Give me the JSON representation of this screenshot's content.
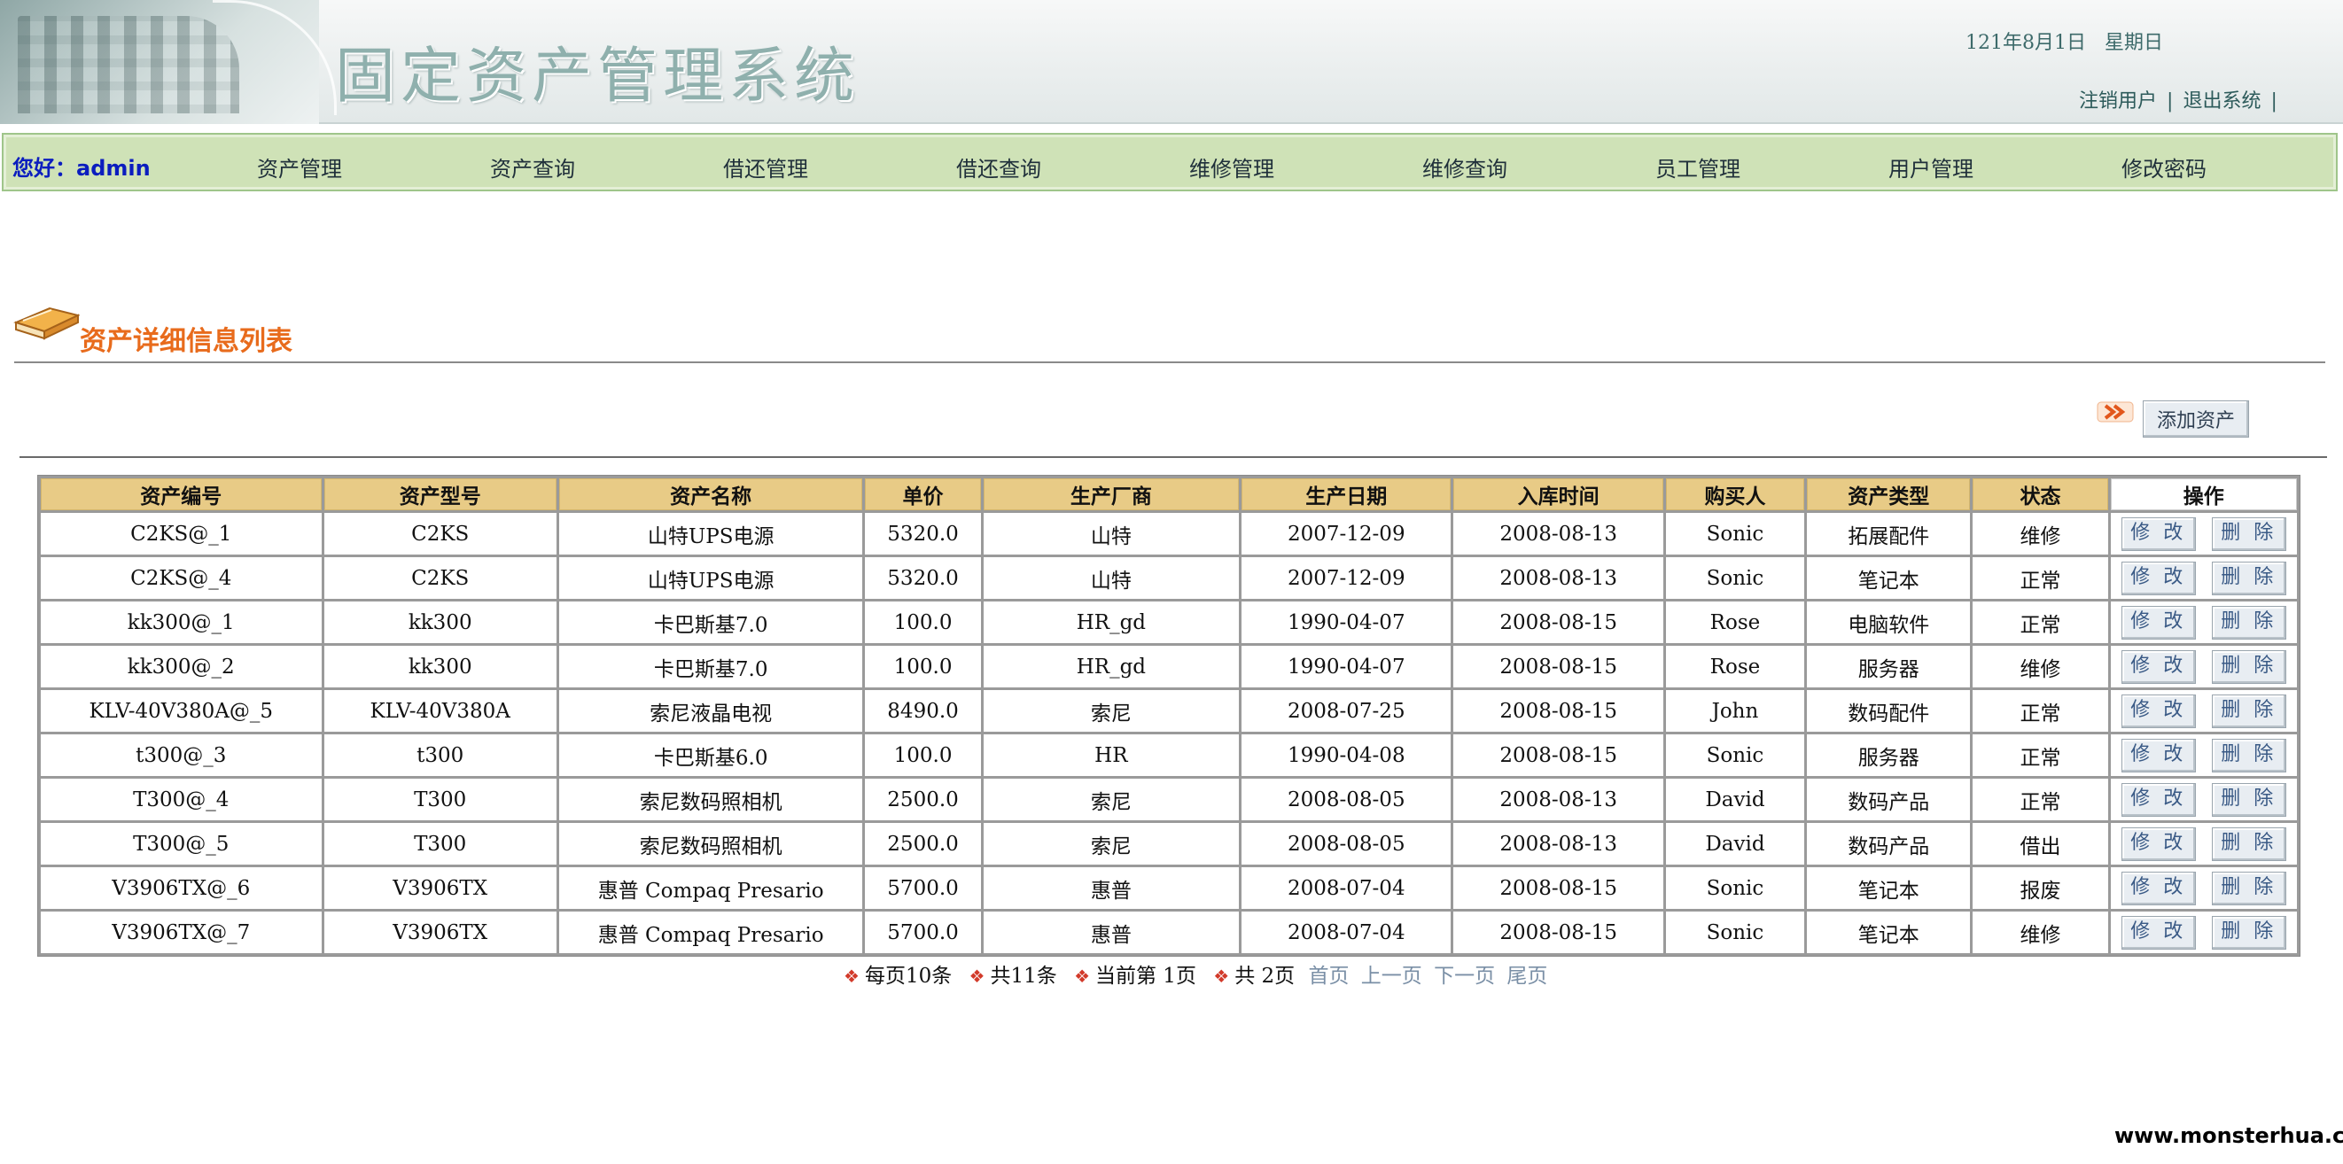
{
  "header": {
    "title": "固定资产管理系统",
    "date_text": "121年8月1日   星期日",
    "logout_user": "注销用户",
    "separator": "|",
    "exit_system": "退出系统",
    "trailing_separator": "|"
  },
  "nav": {
    "greeting": "您好：admin",
    "items": [
      {
        "label": "资产管理"
      },
      {
        "label": "资产查询"
      },
      {
        "label": "借还管理"
      },
      {
        "label": "借还查询"
      },
      {
        "label": "维修管理"
      },
      {
        "label": "维修查询"
      },
      {
        "label": "员工管理"
      },
      {
        "label": "用户管理"
      },
      {
        "label": "修改密码"
      }
    ]
  },
  "section": {
    "title": "资产详细信息列表",
    "add_button": "添加资产"
  },
  "table": {
    "headers": [
      "资产编号",
      "资产型号",
      "资产名称",
      "单价",
      "生产厂商",
      "生产日期",
      "入库时间",
      "购买人",
      "资产类型",
      "状态",
      "操作"
    ],
    "edit_label": "修 改",
    "delete_label": "删 除",
    "rows": [
      [
        "C2KS@_1",
        "C2KS",
        "山特UPS电源",
        "5320.0",
        "山特",
        "2007-12-09",
        "2008-08-13",
        "Sonic",
        "拓展配件",
        "维修"
      ],
      [
        "C2KS@_4",
        "C2KS",
        "山特UPS电源",
        "5320.0",
        "山特",
        "2007-12-09",
        "2008-08-13",
        "Sonic",
        "笔记本",
        "正常"
      ],
      [
        "kk300@_1",
        "kk300",
        "卡巴斯基7.0",
        "100.0",
        "HR_gd",
        "1990-04-07",
        "2008-08-15",
        "Rose",
        "电脑软件",
        "正常"
      ],
      [
        "kk300@_2",
        "kk300",
        "卡巴斯基7.0",
        "100.0",
        "HR_gd",
        "1990-04-07",
        "2008-08-15",
        "Rose",
        "服务器",
        "维修"
      ],
      [
        "KLV-40V380A@_5",
        "KLV-40V380A",
        "索尼液晶电视",
        "8490.0",
        "索尼",
        "2008-07-25",
        "2008-08-15",
        "John",
        "数码配件",
        "正常"
      ],
      [
        "t300@_3",
        "t300",
        "卡巴斯基6.0",
        "100.0",
        "HR",
        "1990-04-08",
        "2008-08-15",
        "Sonic",
        "服务器",
        "正常"
      ],
      [
        "T300@_4",
        "T300",
        "索尼数码照相机",
        "2500.0",
        "索尼",
        "2008-08-05",
        "2008-08-13",
        "David",
        "数码产品",
        "正常"
      ],
      [
        "T300@_5",
        "T300",
        "索尼数码照相机",
        "2500.0",
        "索尼",
        "2008-08-05",
        "2008-08-13",
        "David",
        "数码产品",
        "借出"
      ],
      [
        "V3906TX@_6",
        "V3906TX",
        "惠普 Compaq Presario",
        "5700.0",
        "惠普",
        "2008-07-04",
        "2008-08-15",
        "Sonic",
        "笔记本",
        "报废"
      ],
      [
        "V3906TX@_7",
        "V3906TX",
        "惠普 Compaq Presario",
        "5700.0",
        "惠普",
        "2008-07-04",
        "2008-08-15",
        "Sonic",
        "笔记本",
        "维修"
      ]
    ]
  },
  "pagination": {
    "per_page": "每页10条",
    "total": "共11条",
    "current": "当前第 1页",
    "pages": "共 2页",
    "first": "首页",
    "prev": "上一页",
    "next": "下一页",
    "last": "尾页"
  },
  "footer": {
    "watermark": "www.monsterhua.com"
  },
  "colors": {
    "nav_bg": "#cfe2b7",
    "header_cell_bg": "#e8cb86",
    "section_title": "#e86b1c",
    "greeting": "#0b1dbf"
  }
}
